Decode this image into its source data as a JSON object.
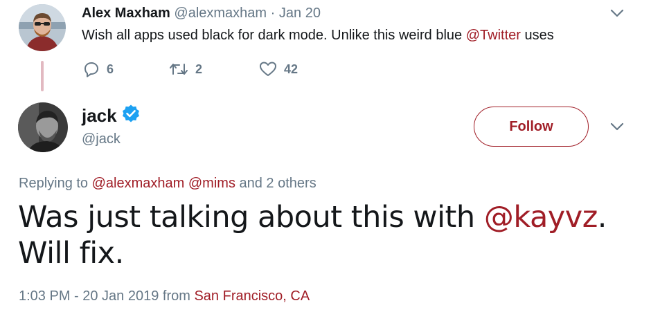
{
  "parent_tweet": {
    "name": "Alex Maxham",
    "handle": "@alexmaxham",
    "separator": "·",
    "date": "Jan 20",
    "text_before": "Wish all apps used black for dark mode. Unlike this weird blue ",
    "mention": "@Twitter",
    "text_after": " uses",
    "reply_count": "6",
    "retweet_count": "2",
    "like_count": "42",
    "icons": {
      "reply": "reply-icon",
      "retweet": "retweet-icon",
      "like": "heart-icon",
      "menu": "chevron-down-icon"
    }
  },
  "main_tweet": {
    "name": "jack",
    "handle": "@jack",
    "follow_label": "Follow",
    "replying_prefix": "Replying to ",
    "replying_mention_1": "@alexmaxham",
    "replying_mention_2": "@mims",
    "replying_suffix": " and 2 others",
    "text_before": "Was just talking about this with ",
    "text_mention": "@kayvz",
    "text_after": ". Will fix.",
    "time": "1:03 PM - 20 Jan 2019 from ",
    "location": "San Francisco, CA",
    "icons": {
      "verified": "verified-badge-icon",
      "menu": "chevron-down-icon"
    }
  },
  "colors": {
    "accent": "#a01d26",
    "secondary_text": "#657786",
    "primary_text": "#14171a",
    "verified": "#1da1f2",
    "thread_line": "#e2b9c1"
  }
}
